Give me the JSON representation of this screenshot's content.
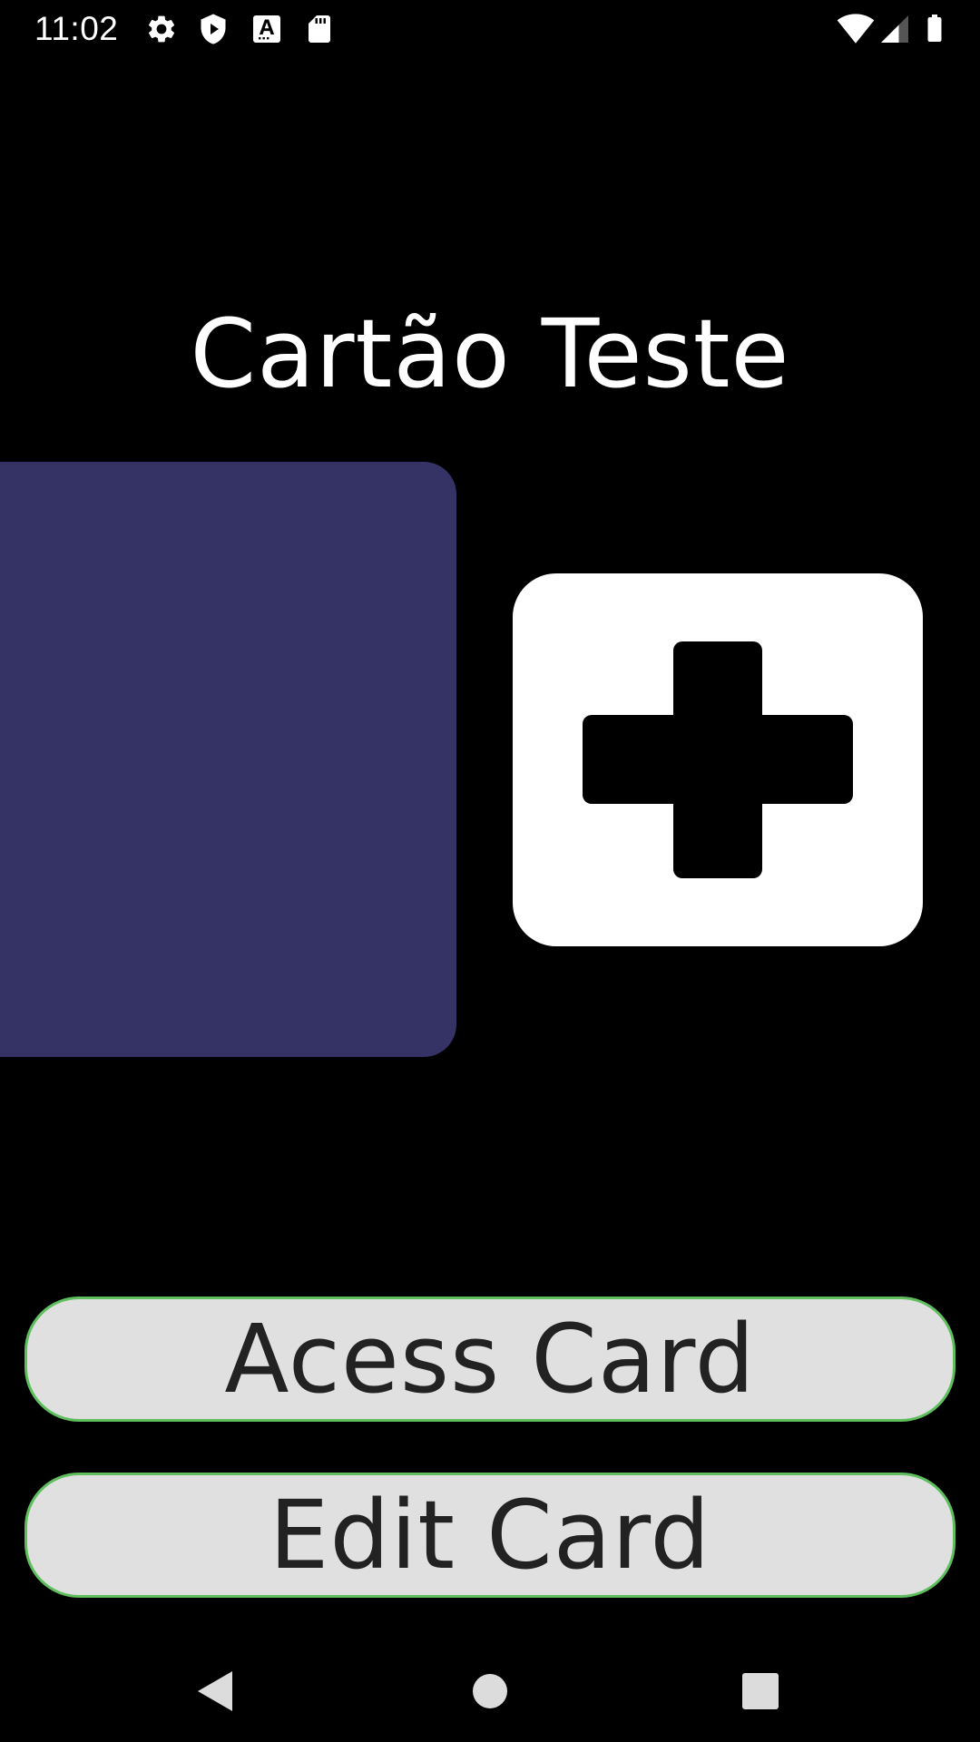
{
  "status_bar": {
    "time": "11:02",
    "left_icons": [
      "gear-icon",
      "shield-play-icon",
      "font-a-icon",
      "sd-card-icon"
    ],
    "right_icons": [
      "wifi-icon",
      "cellular-signal-icon",
      "battery-icon"
    ]
  },
  "card": {
    "title": "Cartão Teste",
    "preview_color": "#353365",
    "add_icon": "plus-icon"
  },
  "actions": {
    "access_label": "Acess Card",
    "edit_label": "Edit Card"
  },
  "nav_bar": {
    "icons": [
      "back-triangle-icon",
      "home-circle-icon",
      "recents-square-icon"
    ]
  },
  "colors": {
    "background": "#000000",
    "button_fill": "#e0e0e0",
    "button_border": "#5fbf5f",
    "nav_icon": "#dcdcdc"
  }
}
